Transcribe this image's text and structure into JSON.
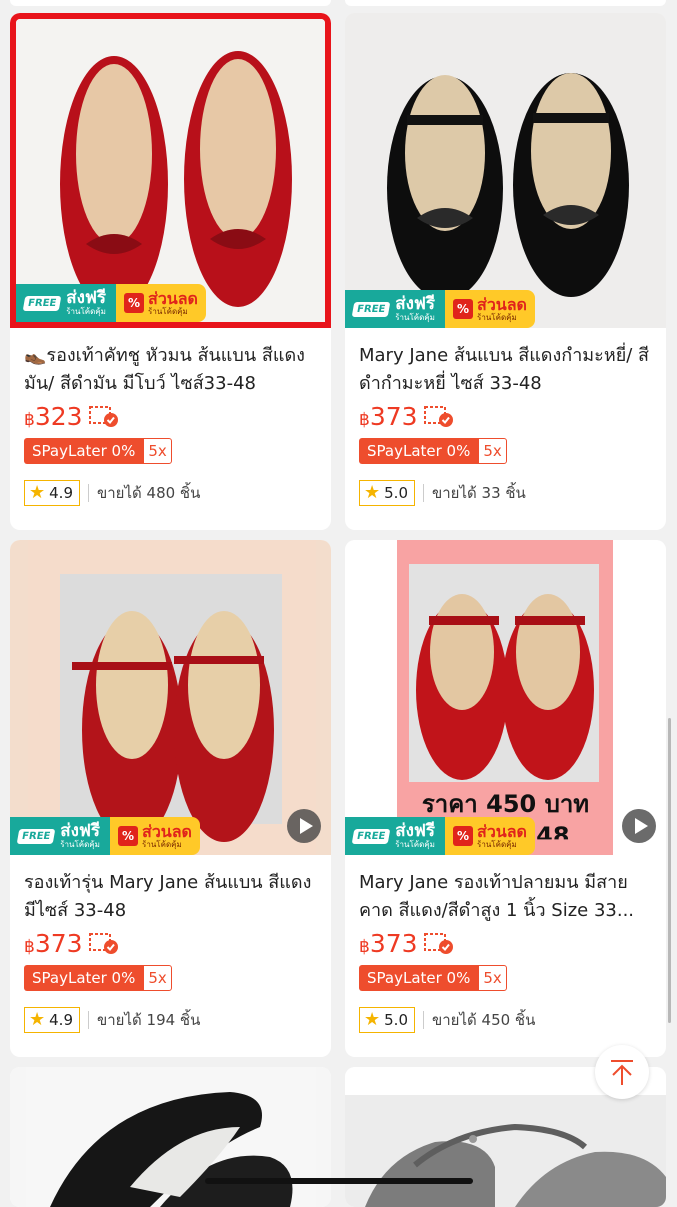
{
  "free_badge": {
    "tag": "FREE",
    "line1": "ส่งฟรี",
    "line2": "ร้านโค้ดคุ้ม"
  },
  "sale_badge": {
    "icon": "%",
    "line1": "ส่วนลด",
    "line2": "ร้านโค้ดคุ้ม"
  },
  "products": [
    {
      "title": "👞รองเท้าคัทชู หัวมน ส้นแบน สีแดงมัน/ สีดำมัน มีโบว์ ไซส์33-48",
      "currency": "฿",
      "price": "323",
      "paylater": "SPayLater 0%",
      "paylater_x": "5x",
      "rating": "4.9",
      "sold": "ขายได้ 480 ชิ้น",
      "shoe_color": "#c4121c"
    },
    {
      "title": "Mary Jane ส้นแบน สีแดงกำมะหยี่/ สีดำกำมะหยี่ ไซส์ 33-48",
      "currency": "฿",
      "price": "373",
      "paylater": "SPayLater 0%",
      "paylater_x": "5x",
      "rating": "5.0",
      "sold": "ขายได้ 33 ชิ้น",
      "shoe_color": "#111111"
    },
    {
      "title": "รองเท้ารุ่น Mary Jane ส้นแบน สีแดง มีไซส์ 33-48",
      "currency": "฿",
      "price": "373",
      "paylater": "SPayLater 0%",
      "paylater_x": "5x",
      "rating": "4.9",
      "sold": "ขายได้ 194 ชิ้น",
      "shoe_color": "#b51419"
    },
    {
      "title": "Mary Jane รองเท้าปลายมน มีสายคาด สีแดง/สีดำสูง 1 นิ้ว Size 33...",
      "currency": "฿",
      "price": "373",
      "paylater": "SPayLater 0%",
      "paylater_x": "5x",
      "rating": "5.0",
      "sold": "ขายได้ 450 ชิ้น",
      "shoe_color": "#c0141a",
      "overlay": "ราคา 450 บาท",
      "overlay_partial": "ไซส์ 33-48"
    }
  ]
}
